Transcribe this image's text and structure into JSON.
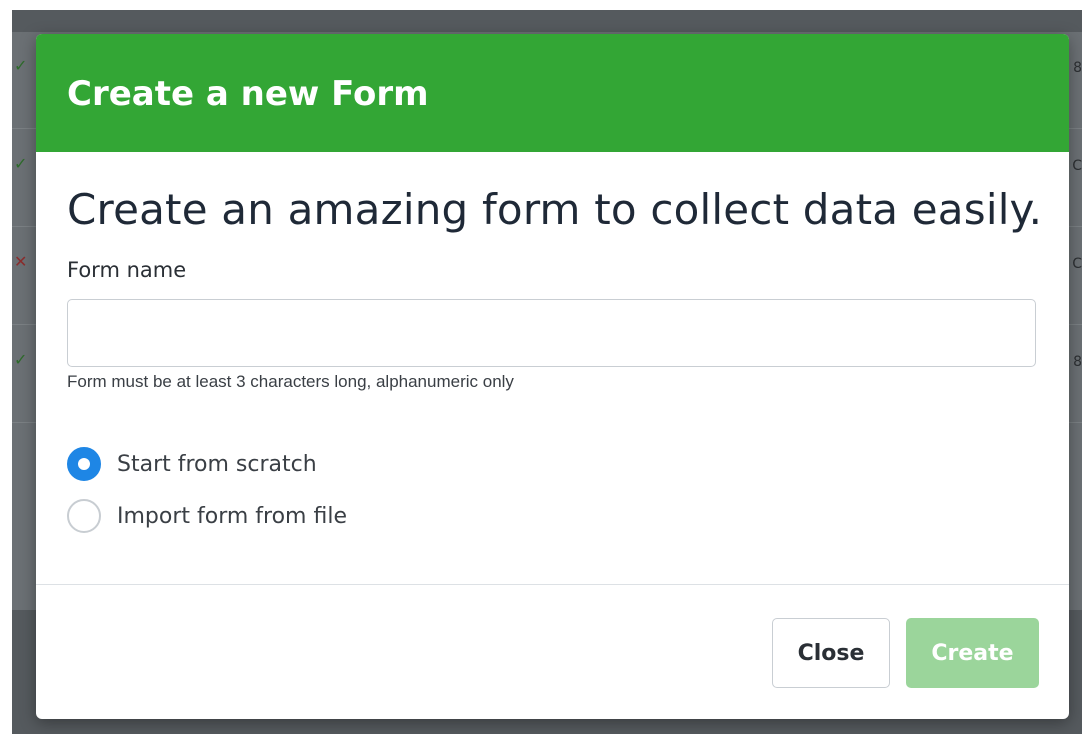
{
  "modal": {
    "title": "Create a new Form",
    "headline": "Create an amazing form to collect data easily.",
    "form_name_label": "Form name",
    "form_name_value": "",
    "form_name_help": "Form must be at least 3 characters long, alphanumeric only",
    "options": [
      {
        "label": "Start from scratch",
        "selected": true
      },
      {
        "label": "Import form from file",
        "selected": false
      }
    ],
    "close_label": "Close",
    "create_label": "Create",
    "create_enabled": false
  },
  "background": {
    "row_marks": [
      "✓",
      "✓",
      "✕",
      "✓"
    ],
    "row_ends": [
      "8",
      "C",
      "C",
      "8"
    ]
  },
  "colors": {
    "header_green": "#33a635",
    "create_disabled_green": "#9bd59b",
    "radio_blue": "#1e86e5"
  }
}
